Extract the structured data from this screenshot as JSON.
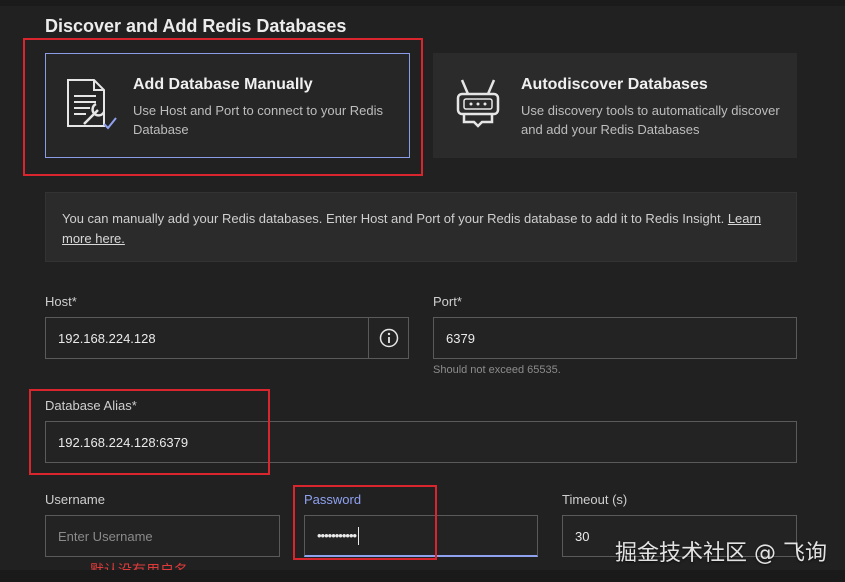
{
  "page": {
    "title": "Discover and Add Redis Databases"
  },
  "cards": [
    {
      "title": "Add Database Manually",
      "description": "Use Host and Port to connect to your Redis Database",
      "icon": "document-wrench-icon",
      "selected": true
    },
    {
      "title": "Autodiscover Databases",
      "description": "Use discovery tools to automatically discover and add your Redis Databases",
      "icon": "robot-icon",
      "selected": false
    }
  ],
  "info": {
    "text": "You can manually add your Redis databases. Enter Host and Port of your Redis database to add it to Redis Insight.",
    "link_text": "Learn more here."
  },
  "form": {
    "host": {
      "label": "Host*",
      "value": "192.168.224.128"
    },
    "port": {
      "label": "Port*",
      "value": "6379",
      "hint": "Should not exceed 65535."
    },
    "alias": {
      "label": "Database Alias*",
      "value": "192.168.224.128:6379"
    },
    "username": {
      "label": "Username",
      "placeholder": "Enter Username"
    },
    "password": {
      "label": "Password",
      "value": "•••••••••••"
    },
    "timeout": {
      "label": "Timeout (s)",
      "value": "30"
    }
  },
  "annotations": {
    "no_username_note": "默认没有用户名",
    "color": "#d9252d"
  },
  "watermark": "掘金技术社区 @ 飞询",
  "colors": {
    "background": "#212121",
    "accent": "#8fa2f0",
    "annotation": "#d9252d"
  }
}
